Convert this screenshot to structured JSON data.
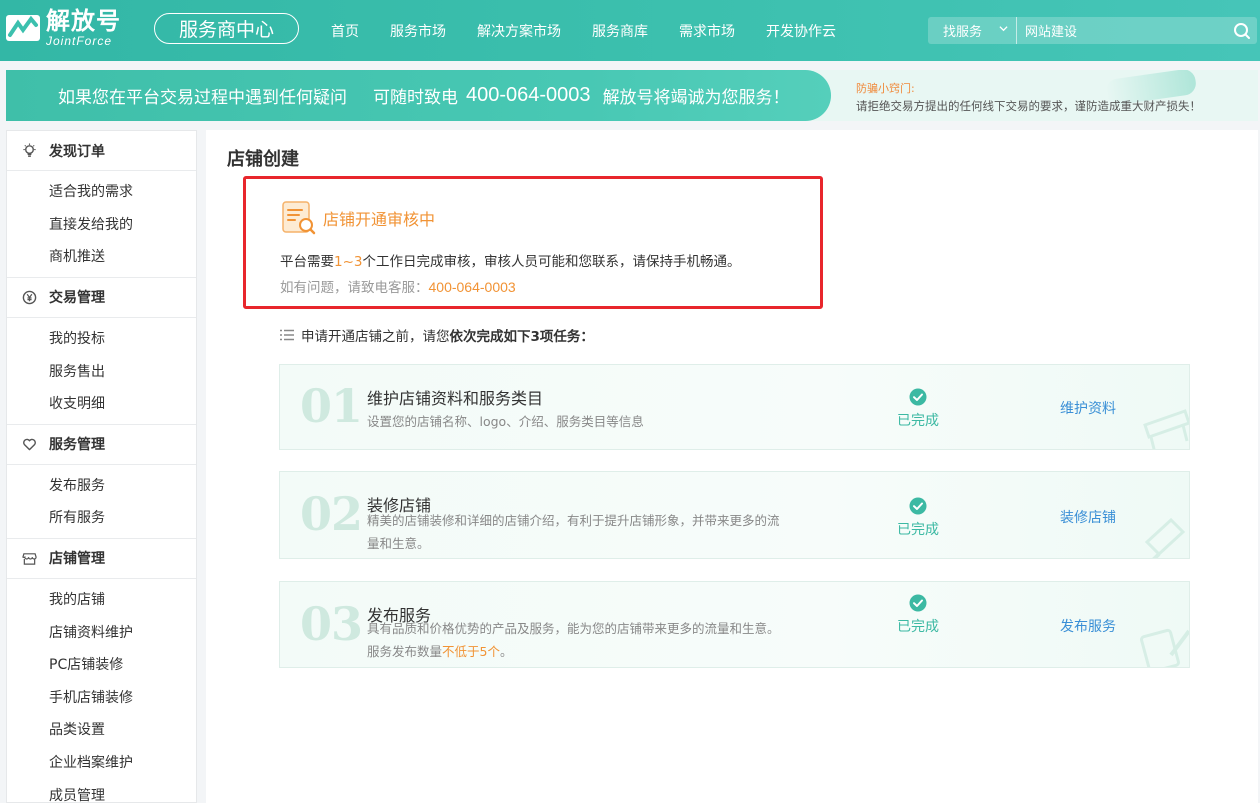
{
  "header": {
    "logo_cn": "解放号",
    "logo_en": "JointForce",
    "center_label": "服务商中心",
    "nav": [
      "首页",
      "服务市场",
      "解决方案市场",
      "服务商库",
      "需求市场",
      "开发协作云"
    ],
    "search_type": "找服务",
    "search_value": "网站建设"
  },
  "banner": {
    "text1": "如果您在平台交易过程中遇到任何疑问",
    "text2": "可随时致电",
    "phone": "400-064-0003",
    "text3": "解放号将竭诚为您服务！",
    "warn_title": "防骗小窍门:",
    "warn_text": "请拒绝交易方提出的任何线下交易的要求，谨防造成重大财产损失！"
  },
  "sidebar": {
    "groups": [
      {
        "title": "发现订单",
        "items": [
          "适合我的需求",
          "直接发给我的",
          "商机推送"
        ]
      },
      {
        "title": "交易管理",
        "items": [
          "我的投标",
          "服务售出",
          "收支明细"
        ]
      },
      {
        "title": "服务管理",
        "items": [
          "发布服务",
          "所有服务"
        ]
      },
      {
        "title": "店铺管理",
        "items": [
          "我的店铺",
          "店铺资料维护",
          "PC店铺装修",
          "手机店铺装修",
          "品类设置",
          "企业档案维护",
          "成员管理"
        ]
      }
    ]
  },
  "main": {
    "title": "店铺创建",
    "review": {
      "title": "店铺开通审核中",
      "text_a": "平台需要",
      "text_hl": "1~3",
      "text_b": "个工作日完成审核，审核人员可能和您联系，请保持手机畅通。",
      "contact_label": "如有问题，请致电客服：",
      "contact_phone": "400-064-0003"
    },
    "intro_a": "申请开通店铺之前，请您",
    "intro_b": "依次完成如下3项任务：",
    "tasks": [
      {
        "num": "01",
        "name": "维护店铺资料和服务类目",
        "desc": "设置您的店铺名称、logo、介绍、服务类目等信息",
        "desc_hl": "",
        "desc_tail": "",
        "status": "已完成",
        "action": "维护资料"
      },
      {
        "num": "02",
        "name": "装修店铺",
        "desc": "精美的店铺装修和详细的店铺介绍，有利于提升店铺形象，并带来更多的流量和生意。",
        "desc_hl": "",
        "desc_tail": "",
        "status": "已完成",
        "action": "装修店铺"
      },
      {
        "num": "03",
        "name": "发布服务",
        "desc": "具有品质和价格优势的产品及服务，能为您的店铺带来更多的流量和生意。 服务发布数量",
        "desc_hl": "不低于5个",
        "desc_tail": "。",
        "status": "已完成",
        "action": "发布服务"
      }
    ]
  },
  "colors": {
    "brand": "#3cc0ae",
    "accent_orange": "#f19335",
    "highlight_red": "#e8262c",
    "link_blue": "#3a8fd6"
  },
  "icons": [
    "logo-mark-icon",
    "chevron-down-icon",
    "search-icon",
    "bulb-icon",
    "yen-icon",
    "heart-icon",
    "shop-icon",
    "review-document-icon",
    "list-icon",
    "check-circle-icon"
  ]
}
